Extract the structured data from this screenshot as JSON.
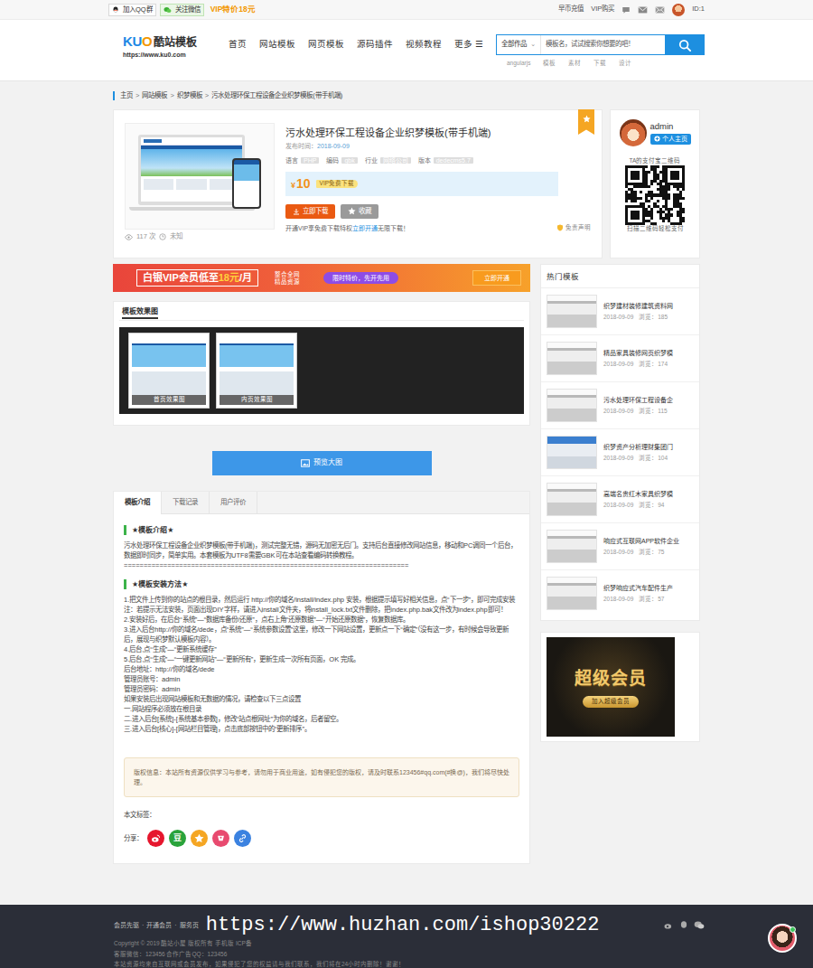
{
  "topbar": {
    "qq_group": "加入QQ群",
    "wechat": "关注微信",
    "vip_promo": "VIP特价18元",
    "links": [
      "早币充值",
      "VIP购买"
    ],
    "user_id": "ID:1"
  },
  "header": {
    "logo_parts": [
      {
        "text": "KU",
        "color": "#1e88e5"
      },
      {
        "text": "O",
        "color": "#f39800"
      }
    ],
    "logo_name": "酷站模板",
    "logo_url": "https://www.ku0.com",
    "nav": [
      {
        "label": "首页",
        "selected": false
      },
      {
        "label": "网站模板",
        "selected": false
      },
      {
        "label": "网页模板",
        "selected": false
      },
      {
        "label": "源码插件",
        "selected": false
      },
      {
        "label": "视频教程",
        "selected": false
      },
      {
        "label": "更多 ☰",
        "selected": false
      }
    ],
    "search": {
      "category": "全部作品",
      "caret": "⌄",
      "placeholder": "模板名，试试搜索你想要的吧！",
      "hot_words": [
        "angularjs",
        "模板",
        "素材",
        "下载",
        "设计"
      ]
    }
  },
  "breadcrumb": {
    "sep": ">",
    "items": [
      "主页",
      "网站模板",
      "织梦模板",
      "污水处理环保工程设备企业织梦模板(带手机端)"
    ]
  },
  "product": {
    "title": "污水处理环保工程设备企业织梦模板(带手机端)",
    "date_label": "发布时间：",
    "date": "2018-09-09",
    "meta": [
      {
        "label": "语言",
        "value": "PHP"
      },
      {
        "label": "编码",
        "value": "gbk"
      },
      {
        "label": "行业",
        "value": "网络公司"
      },
      {
        "label": "版本",
        "value": "dedecms5.7"
      }
    ],
    "price_symbol": "¥",
    "price": "10",
    "vip_badge": "VIP免费下载",
    "download": "立即下载",
    "favorite": "收藏",
    "vip_note": "开通VIP享免费下载特权 ",
    "vip_link": "立即开通",
    "vip_note_end": " 无限下载！",
    "disclaimer": "免责声明",
    "views": "117 次",
    "status": "未知"
  },
  "author": {
    "name": "admin",
    "home_button": "个人主页",
    "qr_title": "TA的支付宝二维码",
    "qr_caption": "扫描二维码轻松支付"
  },
  "banner": {
    "title": "白银VIP会员低至",
    "price": "18元",
    "unit": "/月",
    "side": [
      "整合全网",
      "精品资源"
    ],
    "promo": "限时特价，先开先用",
    "cta": "立即开通"
  },
  "gallery": {
    "title": "模板效果图",
    "thumbs": [
      "首页效果图",
      "内页效果图"
    ]
  },
  "preview_button": "预览大图",
  "tabs": [
    {
      "label": "模板介绍",
      "selected": true
    },
    {
      "label": "下载记录",
      "selected": false
    },
    {
      "label": "用户评价",
      "selected": false
    }
  ],
  "intro": {
    "heading": "★模板介绍★",
    "text": "污水处理环保工程设备企业织梦模板(带手机端)，测试完整无错，源码无加密无后门。支持后台直接修改网站信息，移动和PC调同一个后台，数据即时同步，简单实用。本套模板为UTF8需要GBK可在本站查看编码转换教程。",
    "divider": "========================================================================"
  },
  "install": {
    "heading": "★模板安装方法★",
    "lines": [
      "1.把文件上传到你的站点的根目录，然后运行 http://你的域名/install/index.php 安装，根据提示填写好相关信息，点“下一步”，即可完成安装",
      "注：若提示无法安装，页面出现DIY字样，请进入install文件夹，将install_lock.txt文件删除，把index.php.bak文件改为index.php即可！",
      "2.安装好后，在后台“系统”—“数据库备份/还原”，点右上角“还原数据”—“开始还原数据”，恢复数据库。",
      "3.进入后台http://你的域名/dede，点“系统”—“系统参数设置”这里，修改一下网站设置，更新点一下“确定”（没有这一步，有时候会导致更新后，展现与织梦默认模板内容）。",
      "4.后台,点“生成”—“更新系统缓存”",
      "5.后台,点“生成”—“一键更新网站”—“更新所有”，更新生成一次所有页面，OK 完成。",
      "后台地址：http://你的域名/dede",
      "管理员账号：admin",
      "管理员密码：admin",
      "如果安装后出现网站模板和无数据的情况，请检查以下三点设置",
      "一.网站程序必须放在根目录",
      "二.进入后台[系统]-[系统基本参数]，修改“站点根网址”为你的域名，后者留空。",
      "三.进入后台[核心]-[网站栏目管理]，点击底部按钮中的“更新排序”。"
    ]
  },
  "copyright": "版权信息：本站所有资源仅供学习与参考，请勿用于商业用途，如有侵犯您的版权，请及时联系123456#qq.com(#换@)，我们将尽快处理。",
  "tags_label": "本文标签：",
  "share_label": "分享：",
  "share": [
    {
      "kind": "weibo",
      "color": "#e6162d"
    },
    {
      "kind": "douban",
      "glyph": "豆",
      "color": "#2aa33b"
    },
    {
      "kind": "qzone",
      "color": "#f5a623"
    },
    {
      "kind": "renren",
      "color": "#e84a6f"
    },
    {
      "kind": "link",
      "color": "#3b82e0"
    }
  ],
  "hot": {
    "title": "热门模板",
    "items": [
      {
        "title": "织梦建材装修建筑资料网",
        "date": "2018-09-09",
        "views": "浏览：185"
      },
      {
        "title": "精品家具装修网页织梦模",
        "date": "2018-09-09",
        "views": "浏览：174"
      },
      {
        "title": "污水处理环保工程设备企",
        "date": "2018-09-09",
        "views": "浏览：115"
      },
      {
        "title": "织梦资产分析理财集团门",
        "date": "2018-09-09",
        "views": "浏览：104"
      },
      {
        "title": "高端名贵红木家具织梦模",
        "date": "2018-09-09",
        "views": "浏览：94"
      },
      {
        "title": "响应式互联网APP软件企业",
        "date": "2018-09-09",
        "views": "浏览：75"
      },
      {
        "title": "织梦响应式汽车配件生产",
        "date": "2018-09-09",
        "views": "浏览：57"
      }
    ]
  },
  "vip_ad": {
    "title": "超级会员",
    "button": "加入超级会员"
  },
  "footer": {
    "links": [
      "会员先驱",
      "开通会员",
      "服务页"
    ],
    "link_sep": "·",
    "copyright": "Copyright © 2019 酷站小屋 版权所有 手机版 ICP备",
    "contact": "客服微信：123456 合作广告QQ：123456",
    "notice": "本站资源均来自互联网或会员发布，如果侵犯了您的权益请与我们联系，我们将在24小时内删除！谢谢！"
  },
  "watermark": "https://www.huzhan.com/ishop30222"
}
